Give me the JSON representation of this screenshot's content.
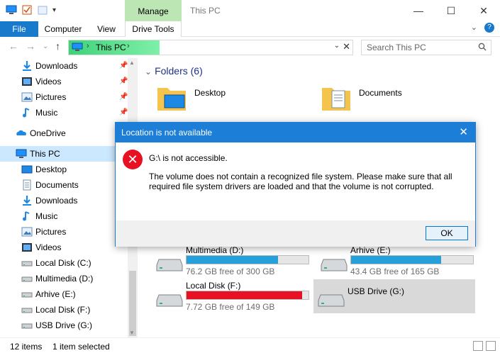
{
  "window": {
    "title": "This PC",
    "manage_tab": "Manage",
    "controls": {
      "minimize": "—",
      "maximize": "☐",
      "close": "✕"
    }
  },
  "ribbon": {
    "tabs": [
      "File",
      "Computer",
      "View",
      "Drive Tools"
    ],
    "expand": "⌄",
    "help": "?"
  },
  "address": {
    "crumb": "This PC",
    "chevron": "›",
    "dropdown": "⌄",
    "clear": "✕"
  },
  "nav": {
    "back": "←",
    "forward": "→",
    "recent": "⌄",
    "up": "↑"
  },
  "search": {
    "placeholder": "Search This PC"
  },
  "sidebar": {
    "items": [
      {
        "label": "Downloads",
        "icon": "download-icon",
        "pinned": true
      },
      {
        "label": "Videos",
        "icon": "video-icon",
        "pinned": true
      },
      {
        "label": "Pictures",
        "icon": "pictures-icon",
        "pinned": true
      },
      {
        "label": "Music",
        "icon": "music-icon",
        "pinned": true
      },
      {
        "label": "OneDrive",
        "icon": "onedrive-icon"
      },
      {
        "label": "This PC",
        "icon": "computer-icon",
        "selected": true
      },
      {
        "label": "Desktop",
        "icon": "desktop-icon"
      },
      {
        "label": "Documents",
        "icon": "documents-icon"
      },
      {
        "label": "Downloads",
        "icon": "download-icon"
      },
      {
        "label": "Music",
        "icon": "music-icon"
      },
      {
        "label": "Pictures",
        "icon": "pictures-icon"
      },
      {
        "label": "Videos",
        "icon": "video-icon"
      },
      {
        "label": "Local Disk (C:)",
        "icon": "drive-icon"
      },
      {
        "label": "Multimedia (D:)",
        "icon": "drive-icon"
      },
      {
        "label": "Arhive (E:)",
        "icon": "drive-icon"
      },
      {
        "label": "Local Disk (F:)",
        "icon": "drive-icon"
      },
      {
        "label": "USB Drive (G:)",
        "icon": "drive-icon"
      }
    ]
  },
  "main": {
    "folders_title": "Folders (6)",
    "folders": [
      {
        "name": "Desktop"
      },
      {
        "name": "Documents"
      }
    ],
    "drives": [
      {
        "name": "Multimedia (D:)",
        "free": "76.2 GB free of 300 GB",
        "used_fraction": 0.75,
        "color": "#26a0da"
      },
      {
        "name": "Arhive (E:)",
        "free": "43.4 GB free of 165 GB",
        "used_fraction": 0.74,
        "color": "#26a0da"
      },
      {
        "name": "Local Disk (F:)",
        "free": "7.72 GB free of 149 GB",
        "used_fraction": 0.95,
        "color": "#e81123"
      },
      {
        "name": "USB Drive (G:)",
        "free": "",
        "selected": true
      }
    ]
  },
  "status": {
    "item_count": "12 items",
    "selected": "1 item selected"
  },
  "dialog": {
    "title": "Location is not available",
    "close": "✕",
    "icon": "error-icon",
    "message1": "G:\\ is not accessible.",
    "message2": "The volume does not contain a recognized file system. Please make sure that all required file system drivers are loaded and that the volume is not corrupted.",
    "ok": "OK"
  },
  "colors": {
    "accent": "#1c7ed6",
    "file_tab": "#1979ca",
    "manage_tab": "#bde6b5",
    "selection": "#cce8ff",
    "error": "#e81123",
    "bar_normal": "#26a0da"
  }
}
